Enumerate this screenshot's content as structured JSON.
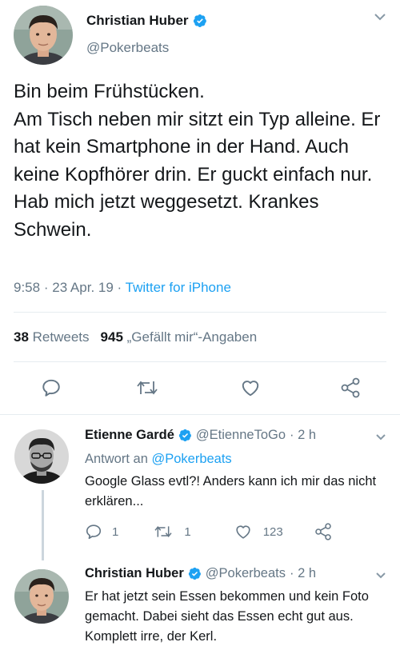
{
  "main_tweet": {
    "author_name": "Christian Huber",
    "author_handle": "@Pokerbeats",
    "text": "Bin beim Frühstücken.\nAm Tisch neben mir sitzt ein Typ alleine. Er hat kein Smartphone in der Hand. Auch keine Kopfhörer drin. Er guckt einfach nur.\nHab mich jetzt weggesetzt. Krankes Schwein.",
    "time": "9:58",
    "date": "23 Apr. 19",
    "separator": "·",
    "source": "Twitter for iPhone",
    "retweet_count": "38",
    "retweet_label": "Retweets",
    "like_count": "945",
    "like_label": "„Gefällt mir“-Angaben",
    "icons": [
      "reply-icon",
      "retweet-icon",
      "like-icon",
      "share-icon"
    ]
  },
  "replies": [
    {
      "author_name": "Etienne Gardé",
      "author_handle": "@EtienneToGo",
      "time": "· 2 h",
      "reply_prefix": "Antwort an",
      "reply_to": "@Pokerbeats",
      "text": "Google Glass evtl?! Anders kann ich mir das nicht erklären...",
      "reply_count": "1",
      "retweet_count": "1",
      "like_count": "123"
    },
    {
      "author_name": "Christian Huber",
      "author_handle": "@Pokerbeats",
      "time": "· 2 h",
      "text": "Er hat jetzt sein Essen bekommen und kein Foto gemacht. Dabei sieht das Essen echt gut aus. Komplett irre, der Kerl."
    }
  ],
  "colors": {
    "primary_text": "#14171a",
    "secondary_text": "#657786",
    "link": "#1da1f2",
    "verified": "#1da1f2",
    "divider": "#e6ecf0",
    "thread_line": "#ccd6dd"
  }
}
